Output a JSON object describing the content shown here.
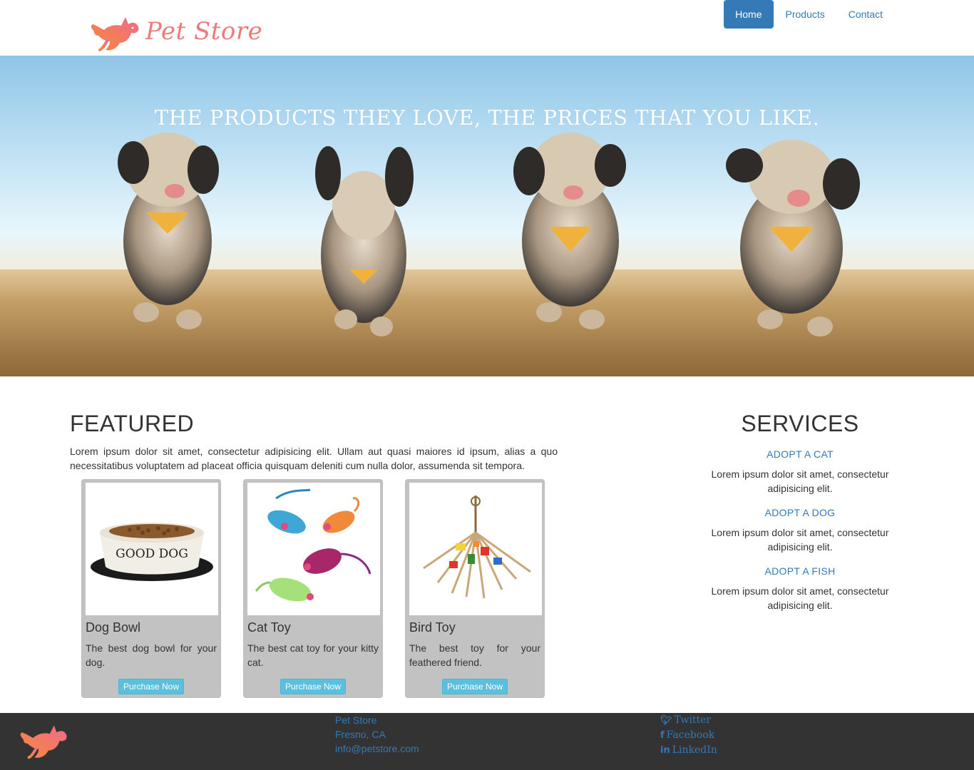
{
  "brand": {
    "name": "Pet Store"
  },
  "nav": {
    "items": [
      {
        "label": "Home",
        "active": true
      },
      {
        "label": "Products",
        "active": false
      },
      {
        "label": "Contact",
        "active": false
      }
    ]
  },
  "hero": {
    "headline": "THE PRODUCTS THEY LOVE, THE PRICES THAT YOU LIKE."
  },
  "featured": {
    "heading": "FEATURED",
    "description": "Lorem ipsum dolor sit amet, consectetur adipisicing elit. Ullam aut quasi maiores id ipsum, alias a quo necessitatibus voluptatem ad placeat officia quisquam deleniti cum nulla dolor, assumenda sit tempora.",
    "products": [
      {
        "name": "Dog Bowl",
        "description": "The best dog bowl for your dog.",
        "button": "Purchase Now",
        "bowl_text": "GOOD DOG"
      },
      {
        "name": "Cat Toy",
        "description": "The best cat toy for your kitty cat.",
        "button": "Purchase Now"
      },
      {
        "name": "Bird Toy",
        "description": "The best toy for your feathered friend.",
        "button": "Purchase Now"
      }
    ]
  },
  "services": {
    "heading": "SERVICES",
    "items": [
      {
        "title": "ADOPT A CAT",
        "description": "Lorem ipsum dolor sit amet, consectetur adipisicing elit."
      },
      {
        "title": "ADOPT A DOG",
        "description": "Lorem ipsum dolor sit amet, consectetur adipisicing elit."
      },
      {
        "title": "ADOPT A FISH",
        "description": "Lorem ipsum dolor sit amet, consectetur adipisicing elit."
      }
    ]
  },
  "footer": {
    "contact": {
      "name": "Pet Store",
      "location": "Fresno, CA",
      "email": "info@petstore.com"
    },
    "social": {
      "twitter": "Twitter",
      "facebook": "Facebook",
      "linkedin": "LinkedIn"
    }
  },
  "colors": {
    "accent": "#337ab7",
    "logo": "#ee7a7a",
    "footer_bg": "#333333",
    "button": "#5bc0de"
  }
}
